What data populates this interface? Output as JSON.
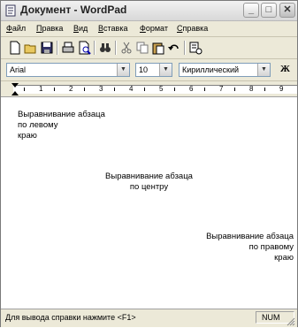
{
  "window": {
    "title": "Документ - WordPad"
  },
  "menu": {
    "items": [
      {
        "accel": "Ф",
        "rest": "айл"
      },
      {
        "accel": "П",
        "rest": "равка"
      },
      {
        "accel": "В",
        "rest": "ид"
      },
      {
        "accel": "В",
        "rest": "ставка"
      },
      {
        "accel": "Ф",
        "rest": "ормат"
      },
      {
        "accel": "С",
        "rest": "правка"
      }
    ]
  },
  "format": {
    "font": "Arial",
    "size": "10",
    "script": "Кириллический",
    "bold_label": "Ж"
  },
  "ruler": {
    "numbers": [
      "1",
      "2",
      "3",
      "4",
      "5",
      "6",
      "7",
      "8",
      "9"
    ]
  },
  "document": {
    "left": [
      "Выравнивание абзаца",
      "по левому",
      "краю"
    ],
    "center": [
      "Выравнивание абзаца",
      "по центру"
    ],
    "right": [
      "Выравнивание абзаца",
      "по правому",
      "краю"
    ]
  },
  "status": {
    "hint": "Для вывода справки нажмите <F1>",
    "num": "NUM"
  }
}
